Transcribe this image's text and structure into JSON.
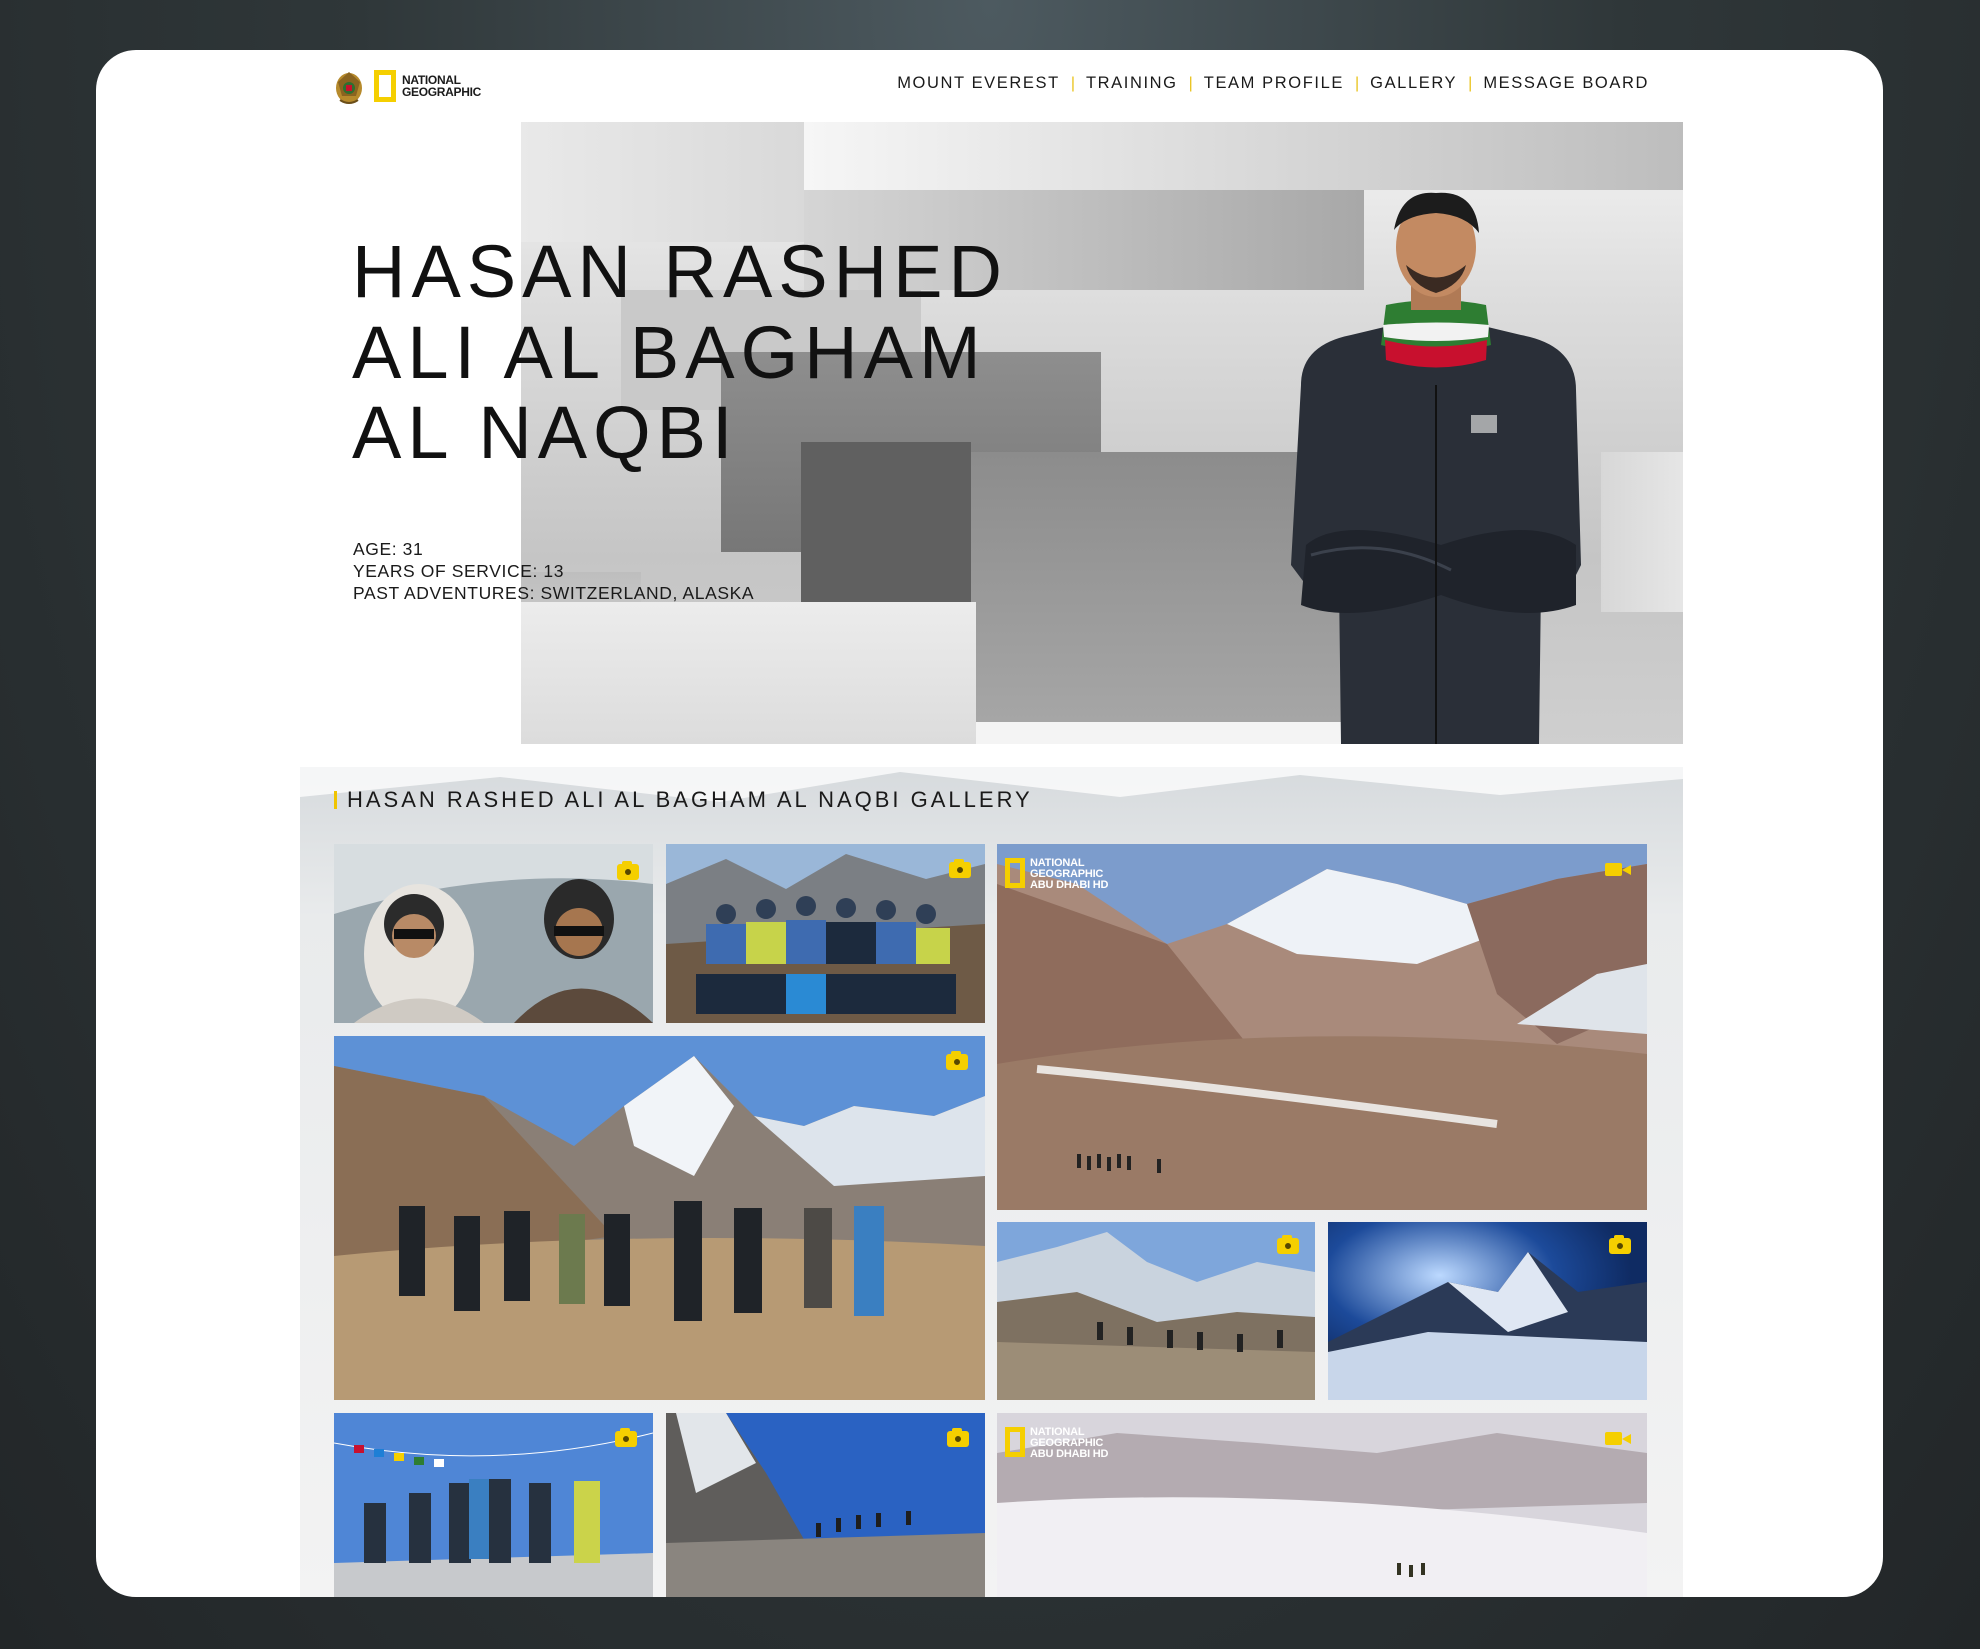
{
  "header": {
    "logo_text_line1": "NATIONAL",
    "logo_text_line2": "GEOGRAPHIC",
    "nav": [
      {
        "label": "MOUNT EVEREST"
      },
      {
        "label": "TRAINING"
      },
      {
        "label": "TEAM PROFILE"
      },
      {
        "label": "GALLERY"
      },
      {
        "label": "MESSAGE BOARD"
      }
    ]
  },
  "hero": {
    "name_line1": "HASAN RASHED",
    "name_line2": "ALI AL BAGHAM",
    "name_line3": "AL NAQBI",
    "age": "AGE: 31",
    "service": "YEARS OF SERVICE: 13",
    "adventures": "PAST ADVENTURES: SWITZERLAND, ALASKA"
  },
  "gallery": {
    "title": "HASAN RASHED ALI AL BAGHAM AL NAQBI GALLERY",
    "watermark_line1": "NATIONAL",
    "watermark_line2": "GEOGRAPHIC",
    "watermark_line3": "ABU DHABI HD",
    "tiles": [
      {
        "id": "helicopter-selfie",
        "media": "photo"
      },
      {
        "id": "team-group-rocks",
        "media": "photo"
      },
      {
        "id": "valley-video",
        "media": "video"
      },
      {
        "id": "trekkers-peak",
        "media": "photo"
      },
      {
        "id": "rocky-trail",
        "media": "photo"
      },
      {
        "id": "everest-night",
        "media": "photo"
      },
      {
        "id": "prayer-flags",
        "media": "photo"
      },
      {
        "id": "boulder-climb",
        "media": "photo"
      },
      {
        "id": "snowfield-video",
        "media": "video"
      }
    ]
  },
  "colors": {
    "accent": "#f5cf00",
    "text": "#111111",
    "card_bg": "#ffffff"
  }
}
